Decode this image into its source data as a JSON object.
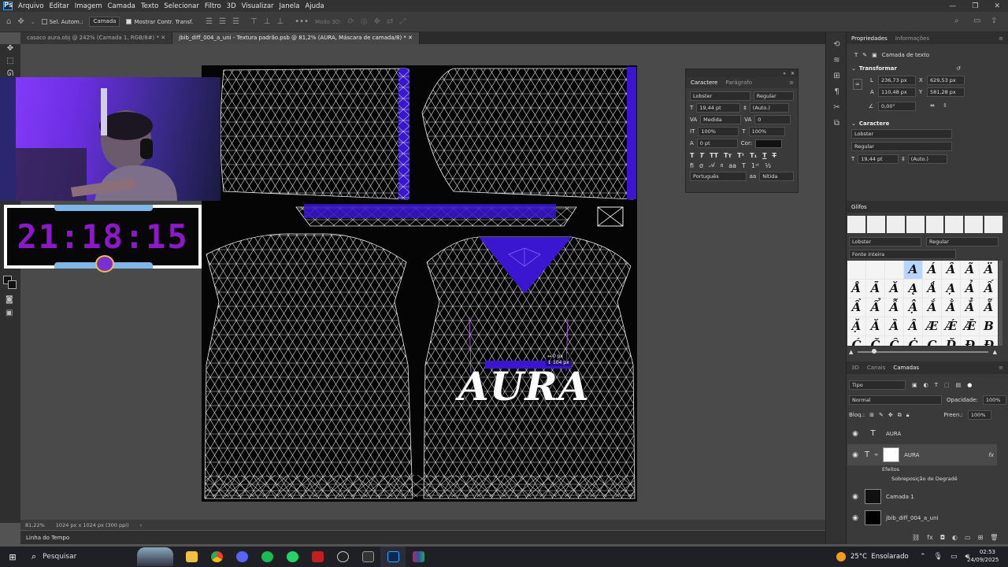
{
  "menu": {
    "logo": "Ps",
    "items": [
      "Arquivo",
      "Editar",
      "Imagem",
      "Camada",
      "Texto",
      "Selecionar",
      "Filtro",
      "3D",
      "Visualizar",
      "Janela",
      "Ajuda"
    ]
  },
  "options": {
    "auto_select_label": "Sel. Autom.:",
    "auto_select_value": "Camada",
    "show_transform_label": "Mostrar Contr. Transf.",
    "mode3d_label": "Modo 3D:"
  },
  "tabs": [
    {
      "label": "casaco aura.obj @ 242% (Camada 1, RGB/8#) *",
      "active": false
    },
    {
      "label": "jbib_diff_004_a_uni - Textura padrão.psb @ 81,2% (AURA, Máscara de camada/8) *",
      "active": true
    }
  ],
  "canvas": {
    "aura_text": "AURA",
    "measure_x": "0 px",
    "measure_y": "104 px"
  },
  "overlay": {
    "clock": "21:18:15"
  },
  "status": {
    "zoom": "81,22%",
    "doc_size": "1024 px x 1024 px (300 ppi)"
  },
  "timeline_label": "Linha do Tempo",
  "char_panel": {
    "tab_character": "Caractere",
    "tab_paragraph": "Parágrafo",
    "font": "Lobster",
    "style": "Regular",
    "size": "19,44 pt",
    "leading": "(Auto.)",
    "kerning": "Medida",
    "tracking": "0",
    "vscale": "100%",
    "hscale": "100%",
    "baseline": "0 pt",
    "color_label": "Cor:",
    "language": "Português",
    "antialias": "Nítida"
  },
  "properties": {
    "tab_properties": "Propriedades",
    "tab_info": "Informações",
    "layer_type": "Camada de texto",
    "transform_title": "Transformar",
    "w_label": "L",
    "w_value": "236,73 px",
    "x_label": "X",
    "x_value": "629,53 px",
    "h_label": "A",
    "h_value": "110,48 px",
    "y_label": "Y",
    "y_value": "581,28 px",
    "angle_value": "0,00°",
    "char_title": "Caractere",
    "font": "Lobster",
    "style": "Regular",
    "size": "19,44 pt",
    "leading": "(Auto.)"
  },
  "glyphs": {
    "title": "Glifos",
    "font": "Lobster",
    "style": "Regular",
    "subset": "Fonte inteira",
    "cells": [
      "",
      "",
      "",
      "A",
      "Á",
      "Â",
      "Ã",
      "Ä",
      "Å",
      "Ā",
      "Ă",
      "Ą",
      "Ǻ",
      "Ạ",
      "Ả",
      "Ấ",
      "Ầ",
      "Ẩ",
      "Ẫ",
      "Ậ",
      "Ắ",
      "Ằ",
      "Ẳ",
      "Ẵ",
      "Ặ",
      "Ǎ",
      "Ȁ",
      "Ȃ",
      "Æ",
      "Ǽ",
      "Ǣ",
      "B",
      "Ć",
      "Č",
      "Ĉ",
      "Ċ",
      "Ç",
      "Ď",
      "Đ",
      "Ð"
    ]
  },
  "layers_panel": {
    "tab_3d": "3D",
    "tab_channels": "Canais",
    "tab_layers": "Camadas",
    "filter": "Tipo",
    "blend": "Normal",
    "opacity_label": "Opacidade:",
    "opacity_value": "100%",
    "lock_label": "Bloq.:",
    "fill_label": "Preen.:",
    "fill_value": "100%",
    "layers": [
      {
        "name": "AURA",
        "type": "text"
      },
      {
        "name": "AURA",
        "type": "text-mask"
      },
      {
        "name": "Camada 1",
        "type": "image"
      },
      {
        "name": "jbib_diff_004_a_uni",
        "type": "image"
      }
    ],
    "effects_label": "Efeitos",
    "effect_name": "Sobreposição de Degradê"
  },
  "taskbar": {
    "search": "Pesquisar",
    "weather": "25°C  Ensolarado",
    "time": "02:53",
    "date": "24/09/2025"
  },
  "colors": {
    "accent_purple": "#3a16d0",
    "clock_purple": "#8d18c8",
    "ps_blue": "#31a8ff"
  }
}
